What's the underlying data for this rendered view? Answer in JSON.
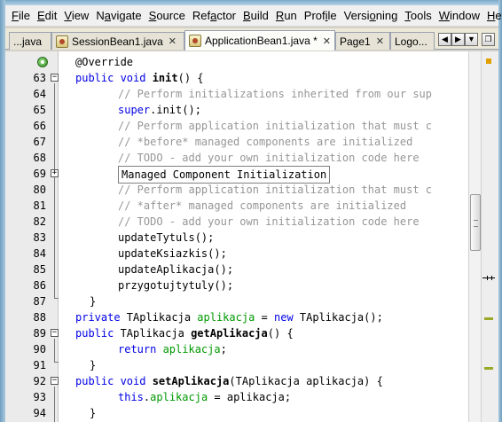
{
  "menu": [
    "File",
    "Edit",
    "View",
    "Navigate",
    "Source",
    "Refactor",
    "Build",
    "Run",
    "Profile",
    "Versioning",
    "Tools",
    "Window",
    "Help"
  ],
  "tabs": [
    {
      "label": "...java"
    },
    {
      "label": "SessionBean1.java",
      "close": "✕"
    },
    {
      "label": "ApplicationBean1.java *",
      "close": "✕",
      "active": true
    },
    {
      "label": "Page1",
      "close": "✕"
    },
    {
      "label": "Logo..."
    }
  ],
  "tab_nav": {
    "left": "◀",
    "right": "▶",
    "list": "▼",
    "restore": "❐"
  },
  "editor": {
    "lines": [
      {
        "num": "",
        "override": true,
        "code": "@Override"
      },
      {
        "num": "63",
        "fold": "−"
      },
      {
        "num": "64"
      },
      {
        "num": "65"
      },
      {
        "num": "66"
      },
      {
        "num": "67"
      },
      {
        "num": "68"
      },
      {
        "num": "69",
        "fold": "+"
      },
      {
        "num": "80"
      },
      {
        "num": "81"
      },
      {
        "num": "82"
      },
      {
        "num": "83"
      },
      {
        "num": "84"
      },
      {
        "num": "85"
      },
      {
        "num": "86"
      },
      {
        "num": "87"
      },
      {
        "num": "88"
      },
      {
        "num": "89",
        "fold": "−"
      },
      {
        "num": "90"
      },
      {
        "num": "91"
      },
      {
        "num": "92",
        "fold": "−"
      },
      {
        "num": "93"
      },
      {
        "num": "94"
      }
    ],
    "text": {
      "l63_kw": "public void ",
      "l63_name": "init",
      "l63_rest": "() {",
      "l64": "// Perform initializations inherited from our sup",
      "l65_kw": "super",
      "l65_rest": ".init();",
      "l66": "// Perform application initialization that must c",
      "l67": "// *before* managed components are initialized",
      "l68": "// TODO - add your own initialization code here",
      "l69": "Managed Component Initialization",
      "l80": "// Perform application initialization that must c",
      "l81": "// *after* managed components are initialized",
      "l82": "// TODO - add your own initialization code here",
      "l83": "updateTytuls();",
      "l84": "updateKsiazkis();",
      "l85": "updateAplikacja();",
      "l86": "przygotujtytuly();",
      "l87": "}",
      "l88_kw": "private ",
      "l88_type": "TAplikacja ",
      "l88_field": "aplikacja",
      "l88_eq": " = ",
      "l88_new": "new ",
      "l88_rest": "TAplikacja();",
      "l89_kw": "public ",
      "l89_type": "TAplikacja ",
      "l89_name": "getAplikacja",
      "l89_rest": "() {",
      "l90_kw": "return ",
      "l90_field": "aplikacja",
      "l90_rest": ";",
      "l91": "}",
      "l92_kw": "public void ",
      "l92_name": "setAplikacja",
      "l92_rest": "(TAplikacja aplikacja) {",
      "l93_kw": "this",
      "l93_dot": ".",
      "l93_field": "aplikacja",
      "l93_rest": " = aplikacja;",
      "l94": "}"
    }
  },
  "colors": {
    "keyword": "#0000e6",
    "comment": "#969696",
    "field": "#009900",
    "marker_warning": "#e0a000",
    "marker_annotation": "#9aa828"
  }
}
